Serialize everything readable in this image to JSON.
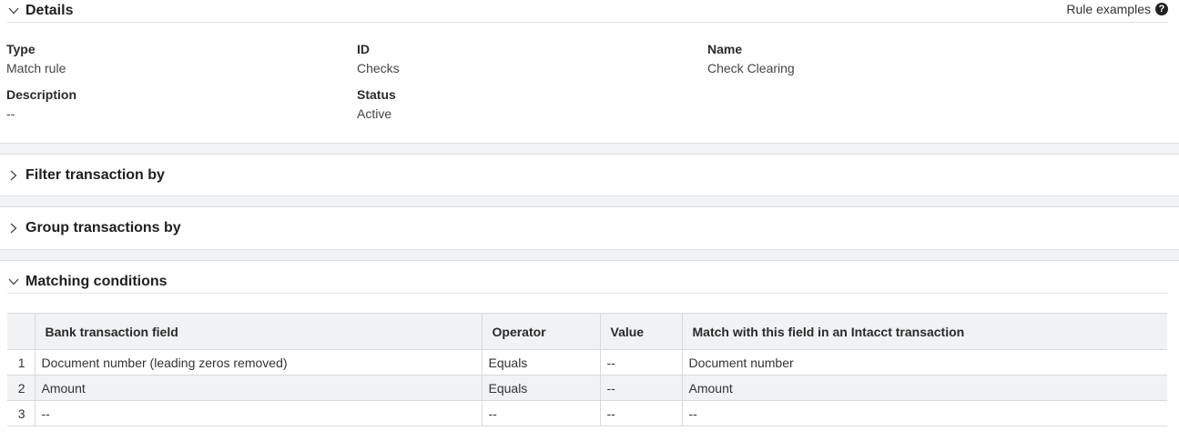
{
  "details": {
    "title": "Details",
    "rule_examples": "Rule examples",
    "fields": {
      "type": {
        "label": "Type",
        "value": "Match rule"
      },
      "id": {
        "label": "ID",
        "value": "Checks"
      },
      "name": {
        "label": "Name",
        "value": "Check Clearing"
      },
      "description": {
        "label": "Description",
        "value": "--"
      },
      "status": {
        "label": "Status",
        "value": "Active"
      }
    }
  },
  "filter": {
    "title": "Filter transaction by"
  },
  "group": {
    "title": "Group transactions by"
  },
  "matching": {
    "title": "Matching conditions",
    "columns": [
      "",
      "Bank transaction field",
      "Operator",
      "Value",
      "Match with this field in an Intacct transaction"
    ],
    "rows": [
      {
        "num": "1",
        "field": "Document number (leading zeros removed)",
        "operator": "Equals",
        "value": "--",
        "match": "Document number"
      },
      {
        "num": "2",
        "field": "Amount",
        "operator": "Equals",
        "value": "--",
        "match": "Amount"
      },
      {
        "num": "3",
        "field": "--",
        "operator": "--",
        "value": "--",
        "match": "--"
      }
    ]
  }
}
